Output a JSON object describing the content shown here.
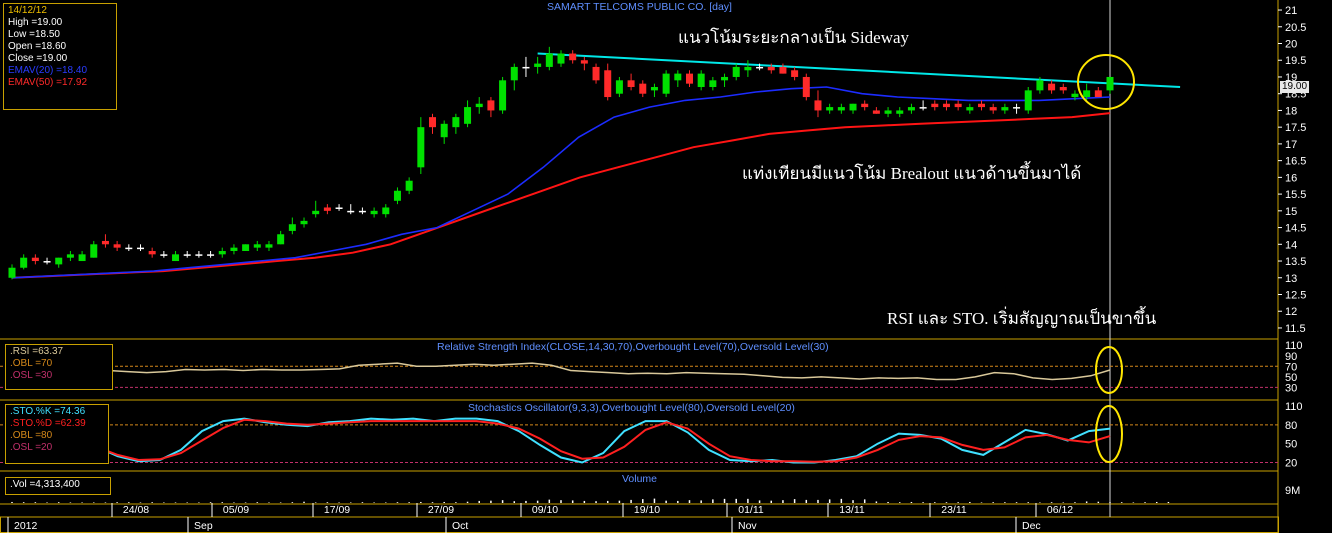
{
  "title": "SAMART TELCOMS PUBLIC CO. [day]",
  "info_box": {
    "date": "14/12/12",
    "high": "High  =19.00",
    "low": "Low   =18.50",
    "open": "Open  =18.60",
    "close": "Close  =19.00",
    "ema_fast": "EMAV(20)   =18.40",
    "ema_slow": "EMAV(50)   =17.92"
  },
  "annotations": {
    "sideway": "แนวโน้มระยะกลางเป็น Sideway",
    "breakout": "แท่งเทียนมีแนวโน้ม Brealout แนวด้านขึ้นมาได้",
    "signal": "RSI และ STO. เริ่มสัญญาณเป็นขาขึ้น"
  },
  "current_price_tag": "19.00",
  "rsi_panel": {
    "title": "Relative Strength Index(CLOSE,14,30,70),Overbought Level(70),Oversold Level(30)",
    "rsi": ".RSI    =63.37",
    "obl": ".OBL    =70",
    "osl": ".OSL    =30"
  },
  "sto_panel": {
    "title": "Stochastics Oscillator(9,3,3),Overbought Level(80),Oversold Level(20)",
    "k": ".STO.%K    =74.36",
    "d": ".STO.%D    =62.39",
    "obl": ".OBL    =80",
    "osl": ".OSL    =20"
  },
  "volume_panel": {
    "title": "Volume",
    "vol": ".Vol   =4,313,400"
  },
  "colors": {
    "up": "#00e000",
    "down": "#ff2a2a",
    "ema20": "#1c2cff",
    "ema50": "#ff1414",
    "trendline": "#00e8e8",
    "rsi": "#d9c89a",
    "sto_k": "#40e0ff",
    "sto_d": "#ff2020",
    "obl": "#d4881a",
    "osl": "#c0306a",
    "highlight": "#ffe600",
    "axis": "#ffffff",
    "frame": "#c8a000"
  },
  "chart_data": {
    "type": "candlestick",
    "title": "SAMART TELCOMS PUBLIC CO. [day]",
    "price_axis": {
      "range": [
        11.2,
        21.3
      ],
      "ticks": [
        "11.5",
        "12",
        "12.5",
        "13",
        "13.5",
        "14",
        "14.5",
        "15",
        "15.5",
        "16",
        "16.5",
        "17",
        "17.5",
        "18",
        "18.5",
        "19",
        "19.5",
        "20",
        "20.5",
        "21"
      ]
    },
    "rsi_axis": {
      "range": [
        8,
        118
      ],
      "ticks": [
        "30",
        "50",
        "70",
        "90",
        "110"
      ]
    },
    "sto_axis": {
      "range": [
        8,
        118
      ],
      "ticks": [
        "20",
        "50",
        "80",
        "110"
      ]
    },
    "volume_axis": {
      "ticks": [
        "9M"
      ],
      "max": 12000000
    },
    "date_ticks": [
      "24/08",
      "05/09",
      "17/09",
      "27/09",
      "09/10",
      "19/10",
      "01/11",
      "13/11",
      "23/11",
      "06/12"
    ],
    "month_ticks": [
      "2012",
      "Sep",
      "Oct",
      "Nov",
      "Dec"
    ],
    "candles": [
      {
        "o": 13.0,
        "h": 13.4,
        "l": 12.95,
        "c": 13.3
      },
      {
        "o": 13.3,
        "h": 13.7,
        "l": 13.25,
        "c": 13.6
      },
      {
        "o": 13.6,
        "h": 13.7,
        "l": 13.4,
        "c": 13.5
      },
      {
        "o": 13.5,
        "h": 13.6,
        "l": 13.4,
        "c": 13.5
      },
      {
        "o": 13.4,
        "h": 13.6,
        "l": 13.3,
        "c": 13.6
      },
      {
        "o": 13.6,
        "h": 13.8,
        "l": 13.5,
        "c": 13.7
      },
      {
        "o": 13.5,
        "h": 13.8,
        "l": 13.5,
        "c": 13.7
      },
      {
        "o": 13.6,
        "h": 14.1,
        "l": 13.6,
        "c": 14.0
      },
      {
        "o": 14.1,
        "h": 14.3,
        "l": 13.9,
        "c": 14.0
      },
      {
        "o": 14.0,
        "h": 14.1,
        "l": 13.8,
        "c": 13.9
      },
      {
        "o": 13.9,
        "h": 14.0,
        "l": 13.8,
        "c": 13.9
      },
      {
        "o": 13.9,
        "h": 14.0,
        "l": 13.8,
        "c": 13.9
      },
      {
        "o": 13.8,
        "h": 13.9,
        "l": 13.6,
        "c": 13.7
      },
      {
        "o": 13.7,
        "h": 13.8,
        "l": 13.6,
        "c": 13.7
      },
      {
        "o": 13.5,
        "h": 13.8,
        "l": 13.5,
        "c": 13.7
      },
      {
        "o": 13.7,
        "h": 13.8,
        "l": 13.6,
        "c": 13.7
      },
      {
        "o": 13.7,
        "h": 13.8,
        "l": 13.6,
        "c": 13.7
      },
      {
        "o": 13.7,
        "h": 13.8,
        "l": 13.6,
        "c": 13.7
      },
      {
        "o": 13.7,
        "h": 13.9,
        "l": 13.6,
        "c": 13.8
      },
      {
        "o": 13.8,
        "h": 14.0,
        "l": 13.7,
        "c": 13.9
      },
      {
        "o": 13.8,
        "h": 14.0,
        "l": 13.8,
        "c": 14.0
      },
      {
        "o": 13.9,
        "h": 14.1,
        "l": 13.8,
        "c": 14.0
      },
      {
        "o": 13.9,
        "h": 14.1,
        "l": 13.8,
        "c": 14.0
      },
      {
        "o": 14.0,
        "h": 14.4,
        "l": 14.0,
        "c": 14.3
      },
      {
        "o": 14.4,
        "h": 14.8,
        "l": 14.3,
        "c": 14.6
      },
      {
        "o": 14.6,
        "h": 14.8,
        "l": 14.5,
        "c": 14.7
      },
      {
        "o": 14.9,
        "h": 15.3,
        "l": 14.8,
        "c": 15.0
      },
      {
        "o": 15.1,
        "h": 15.2,
        "l": 14.9,
        "c": 15.0
      },
      {
        "o": 15.1,
        "h": 15.2,
        "l": 15.0,
        "c": 15.1
      },
      {
        "o": 15.0,
        "h": 15.2,
        "l": 14.9,
        "c": 15.0
      },
      {
        "o": 15.0,
        "h": 15.1,
        "l": 14.9,
        "c": 15.0
      },
      {
        "o": 14.9,
        "h": 15.1,
        "l": 14.8,
        "c": 15.0
      },
      {
        "o": 14.9,
        "h": 15.2,
        "l": 14.8,
        "c": 15.1
      },
      {
        "o": 15.3,
        "h": 15.7,
        "l": 15.2,
        "c": 15.6
      },
      {
        "o": 15.6,
        "h": 16.0,
        "l": 15.5,
        "c": 15.9
      },
      {
        "o": 16.3,
        "h": 17.8,
        "l": 16.1,
        "c": 17.5
      },
      {
        "o": 17.8,
        "h": 17.9,
        "l": 17.3,
        "c": 17.5
      },
      {
        "o": 17.2,
        "h": 17.7,
        "l": 17.0,
        "c": 17.6
      },
      {
        "o": 17.5,
        "h": 17.9,
        "l": 17.3,
        "c": 17.8
      },
      {
        "o": 17.6,
        "h": 18.3,
        "l": 17.5,
        "c": 18.1
      },
      {
        "o": 18.1,
        "h": 18.4,
        "l": 17.9,
        "c": 18.2
      },
      {
        "o": 18.3,
        "h": 18.4,
        "l": 17.8,
        "c": 18.0
      },
      {
        "o": 18.0,
        "h": 19.0,
        "l": 17.9,
        "c": 18.9
      },
      {
        "o": 18.9,
        "h": 19.4,
        "l": 18.6,
        "c": 19.3
      },
      {
        "o": 19.3,
        "h": 19.6,
        "l": 19.0,
        "c": 19.3
      },
      {
        "o": 19.3,
        "h": 19.6,
        "l": 19.1,
        "c": 19.4
      },
      {
        "o": 19.3,
        "h": 19.9,
        "l": 19.2,
        "c": 19.7
      },
      {
        "o": 19.4,
        "h": 19.8,
        "l": 19.3,
        "c": 19.7
      },
      {
        "o": 19.7,
        "h": 19.8,
        "l": 19.4,
        "c": 19.5
      },
      {
        "o": 19.5,
        "h": 19.6,
        "l": 19.2,
        "c": 19.4
      },
      {
        "o": 19.3,
        "h": 19.4,
        "l": 18.8,
        "c": 18.9
      },
      {
        "o": 19.2,
        "h": 19.4,
        "l": 18.3,
        "c": 18.4
      },
      {
        "o": 18.5,
        "h": 19.0,
        "l": 18.4,
        "c": 18.9
      },
      {
        "o": 18.9,
        "h": 19.1,
        "l": 18.6,
        "c": 18.7
      },
      {
        "o": 18.8,
        "h": 18.9,
        "l": 18.4,
        "c": 18.5
      },
      {
        "o": 18.6,
        "h": 18.8,
        "l": 18.4,
        "c": 18.7
      },
      {
        "o": 18.5,
        "h": 19.2,
        "l": 18.4,
        "c": 19.1
      },
      {
        "o": 18.9,
        "h": 19.2,
        "l": 18.7,
        "c": 19.1
      },
      {
        "o": 19.1,
        "h": 19.2,
        "l": 18.7,
        "c": 18.8
      },
      {
        "o": 18.7,
        "h": 19.2,
        "l": 18.6,
        "c": 19.1
      },
      {
        "o": 18.7,
        "h": 19.0,
        "l": 18.6,
        "c": 18.9
      },
      {
        "o": 18.9,
        "h": 19.1,
        "l": 18.7,
        "c": 19.0
      },
      {
        "o": 19.0,
        "h": 19.4,
        "l": 18.9,
        "c": 19.3
      },
      {
        "o": 19.2,
        "h": 19.5,
        "l": 19.0,
        "c": 19.3
      },
      {
        "o": 19.3,
        "h": 19.4,
        "l": 19.2,
        "c": 19.3
      },
      {
        "o": 19.3,
        "h": 19.4,
        "l": 19.1,
        "c": 19.2
      },
      {
        "o": 19.3,
        "h": 19.4,
        "l": 19.1,
        "c": 19.1
      },
      {
        "o": 19.2,
        "h": 19.3,
        "l": 18.9,
        "c": 19.0
      },
      {
        "o": 19.0,
        "h": 19.1,
        "l": 18.3,
        "c": 18.4
      },
      {
        "o": 18.3,
        "h": 18.6,
        "l": 17.8,
        "c": 18.0
      },
      {
        "o": 18.0,
        "h": 18.2,
        "l": 17.9,
        "c": 18.1
      },
      {
        "o": 18.0,
        "h": 18.2,
        "l": 17.9,
        "c": 18.1
      },
      {
        "o": 18.0,
        "h": 18.2,
        "l": 17.9,
        "c": 18.2
      },
      {
        "o": 18.2,
        "h": 18.3,
        "l": 18.0,
        "c": 18.1
      },
      {
        "o": 18.0,
        "h": 18.1,
        "l": 17.9,
        "c": 17.9
      },
      {
        "o": 17.9,
        "h": 18.1,
        "l": 17.8,
        "c": 18.0
      },
      {
        "o": 17.9,
        "h": 18.1,
        "l": 17.8,
        "c": 18.0
      },
      {
        "o": 18.0,
        "h": 18.2,
        "l": 17.9,
        "c": 18.1
      },
      {
        "o": 18.1,
        "h": 18.3,
        "l": 18.0,
        "c": 18.1
      },
      {
        "o": 18.2,
        "h": 18.3,
        "l": 18.0,
        "c": 18.1
      },
      {
        "o": 18.2,
        "h": 18.3,
        "l": 18.0,
        "c": 18.1
      },
      {
        "o": 18.2,
        "h": 18.3,
        "l": 18.0,
        "c": 18.1
      },
      {
        "o": 18.0,
        "h": 18.2,
        "l": 17.9,
        "c": 18.1
      },
      {
        "o": 18.2,
        "h": 18.3,
        "l": 18.0,
        "c": 18.1
      },
      {
        "o": 18.1,
        "h": 18.2,
        "l": 17.9,
        "c": 18.0
      },
      {
        "o": 18.0,
        "h": 18.2,
        "l": 17.9,
        "c": 18.1
      },
      {
        "o": 18.1,
        "h": 18.2,
        "l": 17.9,
        "c": 18.1
      },
      {
        "o": 18.0,
        "h": 18.7,
        "l": 17.9,
        "c": 18.6
      },
      {
        "o": 18.6,
        "h": 19.0,
        "l": 18.5,
        "c": 18.9
      },
      {
        "o": 18.8,
        "h": 18.9,
        "l": 18.5,
        "c": 18.6
      },
      {
        "o": 18.7,
        "h": 18.8,
        "l": 18.5,
        "c": 18.6
      },
      {
        "o": 18.4,
        "h": 18.6,
        "l": 18.3,
        "c": 18.5
      },
      {
        "o": 18.4,
        "h": 18.8,
        "l": 18.3,
        "c": 18.6
      },
      {
        "o": 18.6,
        "h": 18.7,
        "l": 18.4,
        "c": 18.4
      },
      {
        "o": 18.6,
        "h": 19.0,
        "l": 18.5,
        "c": 19.0
      }
    ],
    "ema20": [
      13.0,
      13.05,
      13.1,
      13.15,
      13.2,
      13.3,
      13.4,
      13.5,
      13.6,
      13.8,
      14.0,
      14.3,
      14.5,
      15.0,
      15.5,
      16.3,
      17.2,
      17.8,
      18.1,
      18.3,
      18.4,
      18.55,
      18.65,
      18.7,
      18.5,
      18.4,
      18.35,
      18.3,
      18.3,
      18.3,
      18.35,
      18.4
    ],
    "ema50": [
      13.0,
      13.05,
      13.1,
      13.15,
      13.2,
      13.3,
      13.4,
      13.5,
      13.6,
      13.75,
      14.0,
      14.4,
      14.8,
      15.2,
      15.6,
      16.0,
      16.3,
      16.6,
      16.9,
      17.1,
      17.3,
      17.4,
      17.5,
      17.55,
      17.6,
      17.65,
      17.7,
      17.75,
      17.8,
      17.92
    ],
    "trendline": {
      "from_idx": 45,
      "from_val": 19.7,
      "to_idx": 100,
      "to_val": 18.7
    },
    "rsi": [
      66,
      68,
      66,
      64,
      62,
      62,
      60,
      58,
      60,
      64,
      63,
      64,
      62,
      64,
      63,
      63,
      64,
      65,
      72,
      74,
      76,
      70,
      70,
      72,
      74,
      72,
      74,
      76,
      72,
      62,
      60,
      58,
      56,
      57,
      56,
      58,
      57,
      56,
      55,
      52,
      49,
      48,
      50,
      48,
      46,
      48,
      47,
      48,
      45,
      45,
      50,
      58,
      56,
      48,
      45,
      47,
      52,
      63
    ],
    "sto_k": [
      82,
      82,
      75,
      62,
      45,
      30,
      22,
      24,
      40,
      70,
      86,
      90,
      84,
      80,
      78,
      84,
      86,
      90,
      88,
      90,
      86,
      90,
      90,
      86,
      70,
      48,
      28,
      20,
      35,
      70,
      86,
      86,
      68,
      40,
      24,
      22,
      24,
      20,
      20,
      24,
      30,
      50,
      66,
      64,
      58,
      40,
      32,
      52,
      72,
      65,
      55,
      70,
      74
    ],
    "sto_d": [
      80,
      78,
      72,
      60,
      45,
      32,
      24,
      25,
      35,
      55,
      75,
      88,
      86,
      82,
      80,
      82,
      84,
      86,
      86,
      86,
      86,
      86,
      86,
      82,
      74,
      58,
      38,
      26,
      28,
      45,
      72,
      84,
      74,
      50,
      30,
      24,
      22,
      22,
      21,
      22,
      28,
      40,
      56,
      62,
      60,
      48,
      40,
      44,
      60,
      64,
      56,
      52,
      62
    ],
    "volume": [
      0.4,
      0.3,
      0.3,
      0.2,
      0.3,
      0.2,
      0.2,
      0.2,
      0.2,
      0.3,
      0.3,
      0.2,
      0.3,
      0.2,
      0.2,
      0.2,
      0.2,
      0.3,
      0.3,
      0.2,
      0.2,
      0.3,
      0.2,
      0.2,
      0.3,
      0.5,
      0.2,
      0.3,
      0.2,
      0.2,
      0.3,
      0.2,
      0.2,
      0.3,
      0.3,
      0.4,
      0.3,
      0.4,
      0.3,
      0.5,
      0.8,
      0.9,
      1.1,
      0.7,
      0.8,
      0.9,
      1.3,
      1.1,
      1.0,
      0.8,
      0.7,
      0.8,
      0.9,
      1.2,
      1.5,
      1.7,
      0.9,
      0.8,
      1.1,
      1.0,
      1.4,
      1.6,
      1.6,
      1.6,
      1.0,
      0.9,
      1.1,
      1.5,
      1.2,
      1.2,
      1.4,
      1.6,
      1.1,
      1.4,
      0.6,
      0.4,
      0.3,
      0.4,
      0.3,
      0.3,
      0.3,
      0.3,
      0.4,
      0.2,
      0.3,
      0.3,
      0.3,
      0.3,
      0.2,
      0.3,
      0.2,
      0.3,
      0.6,
      0.5,
      0.3,
      0.3,
      0.2,
      0.3,
      0.4,
      0.4
    ]
  }
}
